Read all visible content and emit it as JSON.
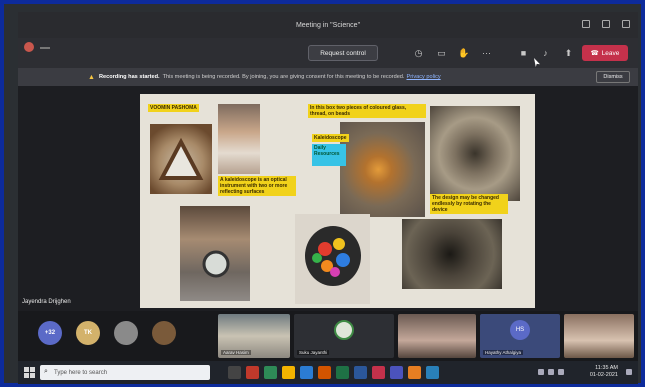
{
  "window": {
    "title": "Meeting in \"Science\""
  },
  "toolbar": {
    "request_control_label": "Request control",
    "leave_label": "Leave",
    "icons": [
      "clock-icon",
      "chat-icon",
      "raise-hand-icon",
      "more-icon",
      "camera-icon",
      "mic-icon",
      "share-icon",
      "phone-icon"
    ]
  },
  "banner": {
    "bold_text": "Recording has started.",
    "message": "This meeting is being recorded. By joining, you are giving consent for this meeting to be recorded.",
    "link_text": "Privacy policy",
    "dismiss_label": "Dismiss"
  },
  "slide": {
    "labels": {
      "title": "VOOMIN PASHOMA",
      "bits": "In this box two pieces of coloured glass, thread, on beads",
      "kaleidoscope": "Kaleidoscope",
      "kal_sub": "Daily Resources",
      "definition": "A kaleidoscope is an optical instrument with two or more reflecting surfaces",
      "design": "The design may be changed endlessly by rotating the device"
    }
  },
  "presenter": {
    "name": "Jayendra Drijghen"
  },
  "participants": {
    "avatars": [
      {
        "initials": "+32",
        "color": "#5b6ac7"
      },
      {
        "initials": "TK",
        "color": "#d3b26b"
      },
      {
        "initials": "",
        "color": "#8a8a8a"
      },
      {
        "initials": "",
        "color": "#7a5a3a"
      }
    ],
    "tile_names": [
      "Aarav Hasim",
      "Suku Jayanthi",
      "",
      "Hayathy Athalgiya",
      ""
    ],
    "hs_badge": "HS"
  },
  "taskbar": {
    "search_placeholder": "Type here to search",
    "time": "11:35 AM",
    "date": "01-02-2021"
  },
  "colors": {
    "frame": "#0d2b9c",
    "leave": "#c4314b",
    "highlight": "#f1d21b"
  }
}
